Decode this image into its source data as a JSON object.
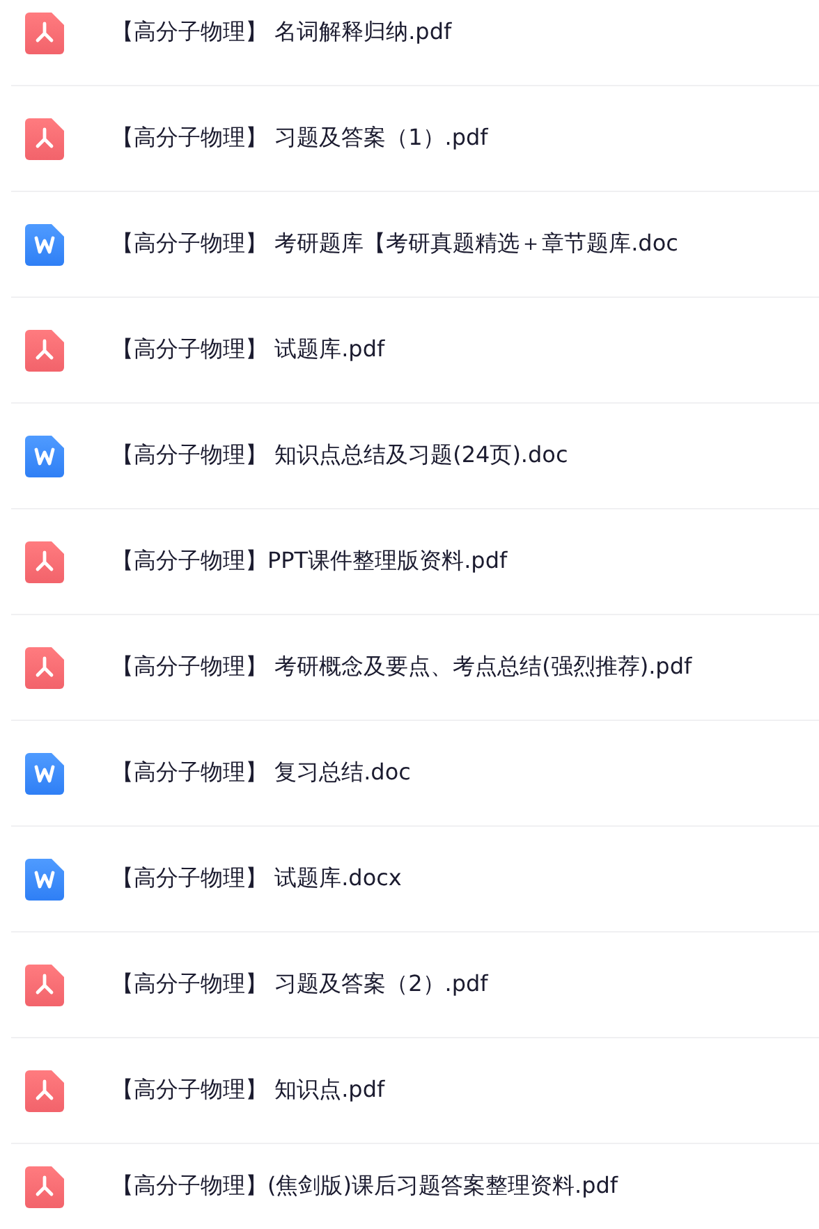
{
  "files": [
    {
      "kind": "pdf",
      "name": "【高分子物理】 名词解释归纳.pdf"
    },
    {
      "kind": "pdf",
      "name": "【高分子物理】 习题及答案（1）.pdf"
    },
    {
      "kind": "word",
      "name": "【高分子物理】 考研题库【考研真题精选＋章节题库.doc"
    },
    {
      "kind": "pdf",
      "name": "【高分子物理】 试题库.pdf"
    },
    {
      "kind": "word",
      "name": "【高分子物理】 知识点总结及习题(24页).doc"
    },
    {
      "kind": "pdf",
      "name": "【高分子物理】PPT课件整理版资料.pdf"
    },
    {
      "kind": "pdf",
      "name": "【高分子物理】 考研概念及要点、考点总结(强烈推荐).pdf"
    },
    {
      "kind": "word",
      "name": "【高分子物理】 复习总结.doc"
    },
    {
      "kind": "word",
      "name": "【高分子物理】 试题库.docx"
    },
    {
      "kind": "pdf",
      "name": "【高分子物理】 习题及答案（2）.pdf"
    },
    {
      "kind": "pdf",
      "name": "【高分子物理】 知识点.pdf"
    },
    {
      "kind": "pdf",
      "name": "【高分子物理】(焦剑版)课后习题答案整理资料.pdf"
    }
  ]
}
